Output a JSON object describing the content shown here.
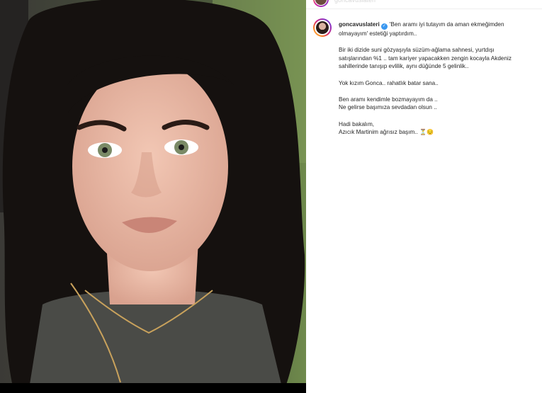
{
  "post": {
    "top_username": "goncavuslateri",
    "username": "goncavuslateri",
    "verified_icon": "verified-badge-icon",
    "caption_first": "'Ben aramı iyi tutayım da aman ekmeğimden olmayayım' estetiği yaptırdım..",
    "paragraph_2_line_1": "Bir iki dizide suni gözyaşıyla süzüm-ağlama sahnesi, yurtdışı",
    "paragraph_2_line_2": "satışlarından %1 .. tam kariyer yapacakken zengin kocayla Akdeniz",
    "paragraph_2_line_3": "sahillerinde tanışıp evlilik, aynı düğünde 5 gelinlik..",
    "paragraph_3": "Yok kızım Gonca.. rahatlık batar sana..",
    "paragraph_4_line_1": "Ben aramı kendimle bozmayayım da ..",
    "paragraph_4_line_2": "Ne gelirse başımıza sevdadan olsun ..",
    "paragraph_5_line_1": "Hadi bakalım,",
    "paragraph_5_line_2": "Azıcık Martinim ağrısız başım..",
    "emojis": "⏳😔"
  },
  "colors": {
    "accent_blue": "#3897f0",
    "text": "#262626"
  }
}
